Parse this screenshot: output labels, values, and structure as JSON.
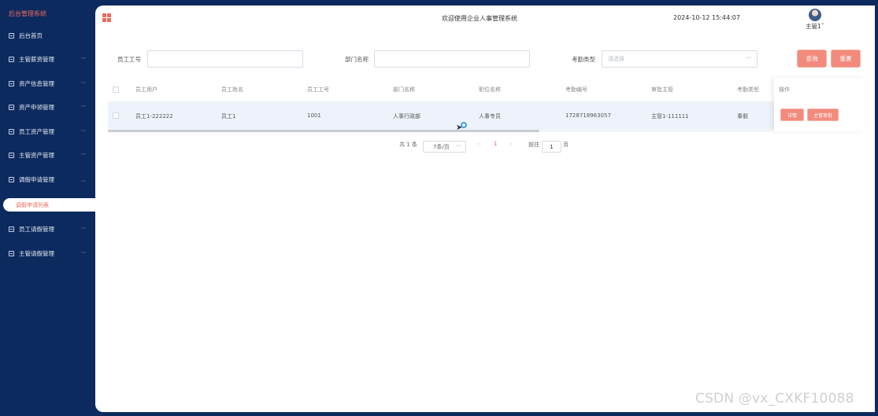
{
  "sidebar": {
    "brand": "后台管理系统",
    "items": [
      {
        "label": "后台首页"
      },
      {
        "label": "主管薪资管理"
      },
      {
        "label": "资产信息管理"
      },
      {
        "label": "资产申领管理"
      },
      {
        "label": "员工资产管理"
      },
      {
        "label": "主管资产管理"
      },
      {
        "label": "调假申请管理"
      },
      {
        "label": "员工请假管理"
      },
      {
        "label": "主管请假管理"
      }
    ],
    "active_submenu": "调假申请列表"
  },
  "header": {
    "welcome": "欢迎使用企业人事管理系统",
    "datetime": "2024-10-12 15:44:07",
    "user": "主管1"
  },
  "search": {
    "employee_no_label": "员工工号",
    "employee_no_value": "",
    "department_label": "部门名称",
    "department_value": "",
    "attendance_type_label": "考勤类型",
    "attendance_type_placeholder": "请选择",
    "query_button": "查询",
    "reset_button": "重置"
  },
  "table": {
    "headers": [
      "员工用户",
      "员工姓名",
      "员工工号",
      "部门名称",
      "职位名称",
      "考勤编号",
      "审批主管",
      "考勤类型",
      "操作"
    ],
    "rows": [
      {
        "user": "员工1-222222",
        "name": "员工1",
        "employee_no": "1001",
        "department": "人事行政部",
        "position": "人事专员",
        "attendance_no": "1728718963057",
        "approver": "主管1-111111",
        "attendance_type": "事假",
        "op_detail": "详情",
        "op_approve": "主管审批"
      }
    ]
  },
  "pagination": {
    "total": "共 1 条",
    "page_size": "7条/页",
    "prev": "‹",
    "current_page": "1",
    "next": "›",
    "goto_label": "前往",
    "goto_value": "1",
    "page_unit": "页"
  },
  "watermark": "CSDN @vx_CXKF10088",
  "colors": {
    "sidebar_bg": "#0d2a5e",
    "accent": "#f06a5e",
    "button": "#f28b7d"
  }
}
